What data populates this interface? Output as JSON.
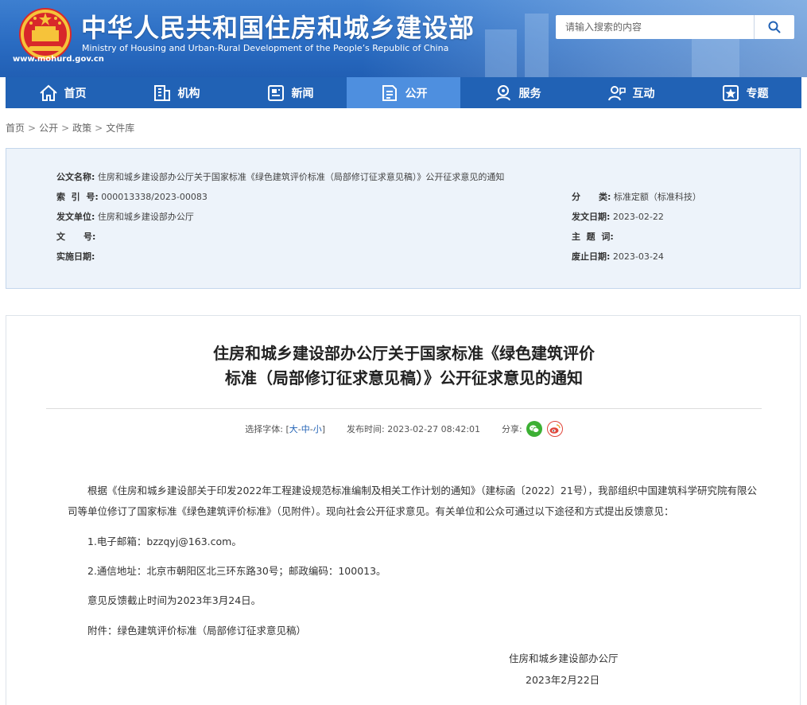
{
  "header": {
    "site_title": "中华人民共和国住房和城乡建设部",
    "site_subtitle": "Ministry of Housing and Urban-Rural Development of the People’s Republic of China",
    "site_url": "www.mohurd.gov.cn",
    "search_placeholder": "请输入搜索的内容",
    "colors": {
      "header_blue": "#2a6cc2",
      "nav_blue": "#2162b5",
      "nav_active": "#4e8fdf"
    }
  },
  "nav": {
    "items": [
      {
        "label": "首页",
        "icon": "home-icon"
      },
      {
        "label": "机构",
        "icon": "building-icon"
      },
      {
        "label": "新闻",
        "icon": "news-icon"
      },
      {
        "label": "公开",
        "icon": "disclosure-icon",
        "active": true
      },
      {
        "label": "服务",
        "icon": "service-icon"
      },
      {
        "label": "互动",
        "icon": "interaction-icon"
      },
      {
        "label": "专题",
        "icon": "topic-icon"
      }
    ]
  },
  "breadcrumb": [
    "首页",
    "公开",
    "政策",
    "文件库"
  ],
  "info": {
    "doc_name_label": "公文名称:",
    "doc_name": "住房和城乡建设部办公厅关于国家标准《绿色建筑评价标准（局部修订征求意见稿）》公开征求意见的通知",
    "index_label": "索  引  号:",
    "index": "000013338/2023-00083",
    "category_label": "分      类:",
    "category": "标准定额（标准科技）",
    "issuer_label": "发文单位:",
    "issuer": "住房和城乡建设部办公厅",
    "issue_date_label": "发文日期:",
    "issue_date": "2023-02-22",
    "doc_no_label": "文      号:",
    "doc_no": "",
    "subject_label": "主  题  词:",
    "subject": "",
    "effective_label": "实施日期:",
    "effective": "",
    "expire_label": "废止日期:",
    "expire": "2023-03-24"
  },
  "article": {
    "title_line1": "住房和城乡建设部办公厅关于国家标准《绿色建筑评价",
    "title_line2": "标准（局部修订征求意见稿）》公开征求意见的通知",
    "font_size_label": "选择字体:",
    "font_size_bracket_open": "[",
    "font_size_large": "大",
    "font_size_dash1": "-",
    "font_size_medium": "中",
    "font_size_dash2": "-",
    "font_size_small": "小",
    "font_size_bracket_close": "]",
    "publish_label": "发布时间:",
    "publish_time": "2023-02-27 08:42:01",
    "share_label": "分享:",
    "paragraph1": "根据《住房和城乡建设部关于印发2022年工程建设规范标准编制及相关工作计划的通知》（建标函〔2022〕21号），我部组织中国建筑科学研究院有限公司等单位修订了国家标准《绿色建筑评价标准》（见附件）。现向社会公开征求意见。有关单位和公众可通过以下途径和方式提出反馈意见：",
    "item1": "1.电子邮箱：bzzqyj@163.com。",
    "item2": "2.通信地址：北京市朝阳区北三环东路30号；邮政编码：100013。",
    "deadline": "意见反馈截止时间为2023年3月24日。",
    "attachment_label": "附件：",
    "attachment_link": "绿色建筑评价标准（局部修订征求意见稿）",
    "signature": "住房和城乡建设部办公厅",
    "sign_date": "2023年2月22日"
  }
}
